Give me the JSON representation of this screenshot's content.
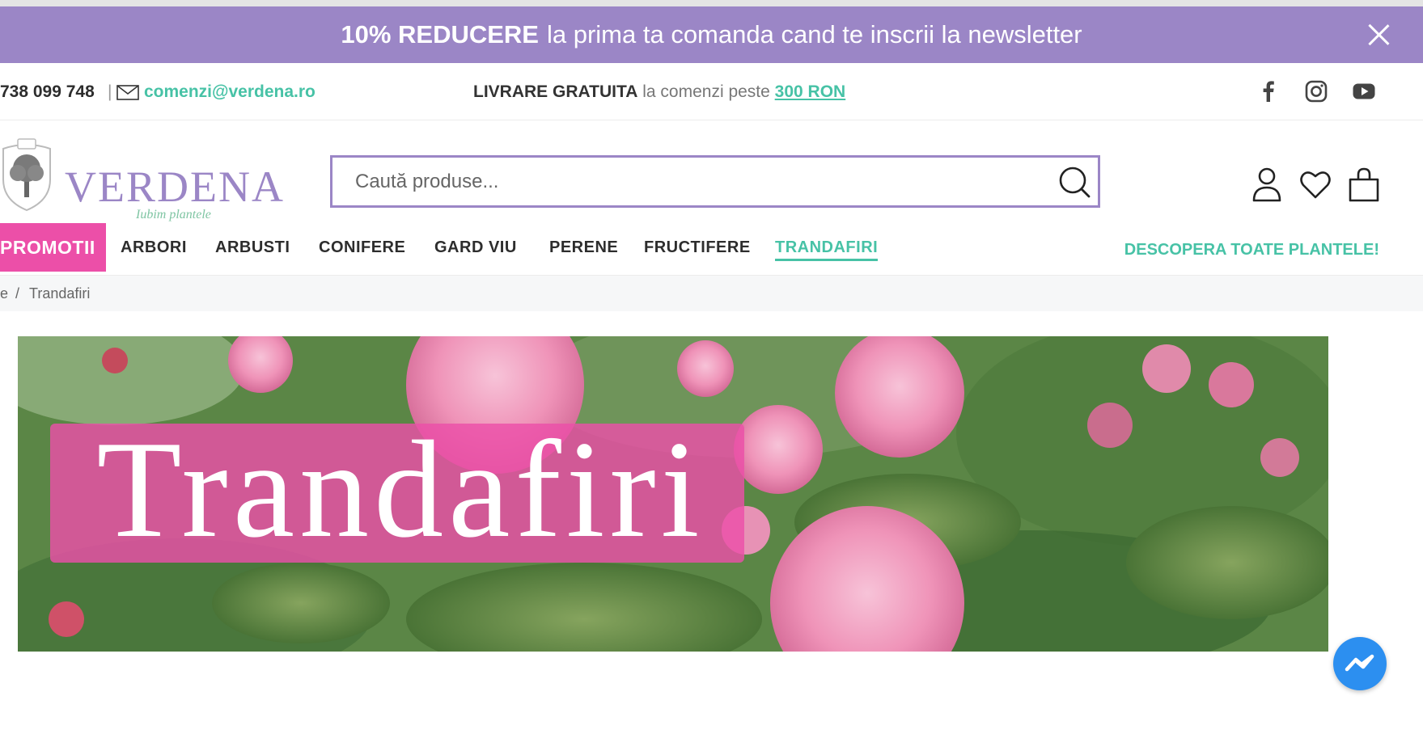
{
  "promo": {
    "strong": "10% REDUCERE",
    "text": "la prima ta comanda cand te inscrii la newsletter"
  },
  "infobar": {
    "phone": "738 099 748",
    "separator": "|",
    "email": "comenzi@verdena.ro",
    "shipping_bold": "LIVRARE GRATUITA",
    "shipping_text": "la comenzi peste",
    "shipping_amount": "300 RON"
  },
  "header": {
    "logo_text": "VERDENA",
    "logo_tagline": "Iubim plantele",
    "search_placeholder": "Caută produse..."
  },
  "nav": {
    "items": [
      "PROMOTII",
      "ARBORI",
      "ARBUSTI",
      "CONIFERE",
      "GARD VIU",
      "PERENE",
      "FRUCTIFERE",
      "TRANDAFIRI"
    ],
    "all_plants": "DESCOPERA TOATE PLANTELE!"
  },
  "breadcrumb": {
    "prev": "e",
    "slash": "/",
    "current": "Trandafiri"
  },
  "hero": {
    "title": "Trandafiri"
  },
  "colors": {
    "brand_purple": "#9b86c6",
    "accent_green": "#47c2a6",
    "promo_pink": "#ec4fa8"
  },
  "icons": [
    "close-icon",
    "mail-icon",
    "facebook-icon",
    "instagram-icon",
    "youtube-icon",
    "search-icon",
    "user-icon",
    "heart-icon",
    "bag-icon",
    "messenger-icon"
  ]
}
